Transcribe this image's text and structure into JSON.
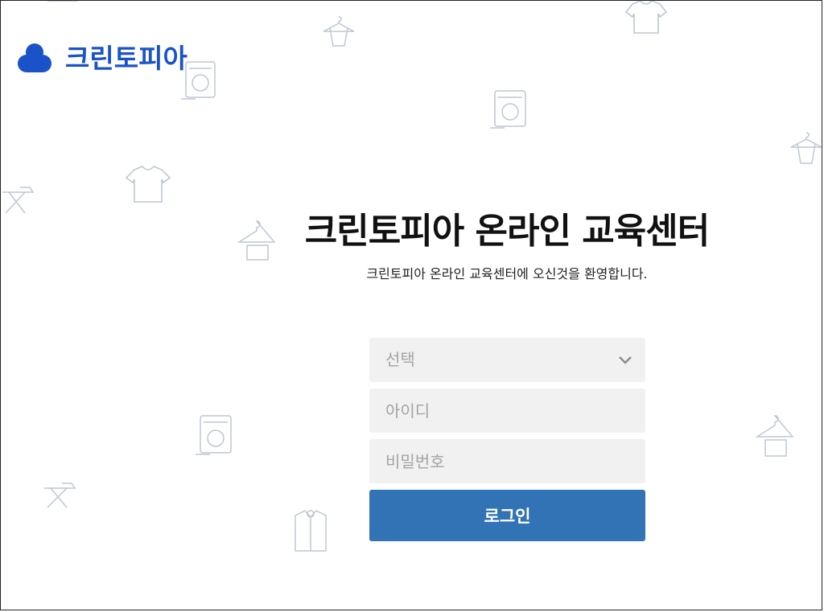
{
  "brand": {
    "name": "크린토피아",
    "color": "#1a53c9"
  },
  "main": {
    "title": "크린토피아 온라인 교육센터",
    "subtitle": "크린토피아 온라인 교육센터에 오신것을 환영합니다."
  },
  "form": {
    "select": {
      "value": "선택",
      "icon": "chevron-down-icon"
    },
    "username": {
      "placeholder": "아이디"
    },
    "password": {
      "placeholder": "비밀번호"
    },
    "submit_label": "로그인",
    "submit_color": "#3273b5"
  },
  "background_icons": [
    "tshirt-icon",
    "shirt-hanger-icon",
    "washing-machine-icon",
    "ironing-board-icon",
    "hanger-icon",
    "dress-shirt-icon"
  ]
}
